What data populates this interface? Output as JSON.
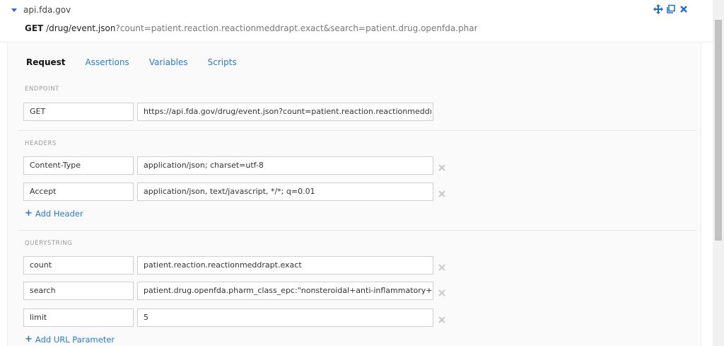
{
  "request_header": {
    "host": "api.fda.gov",
    "method": "GET",
    "path": "/drug/event.json",
    "query": "?count=patient.reaction.reactionmeddrapt.exact&search=patient.drug.openfda.pharm_class_ep"
  },
  "icons": {
    "move": "move-icon",
    "copy": "copy-icon",
    "close": "close-icon"
  },
  "tabs": [
    {
      "label": "Request",
      "active": true
    },
    {
      "label": "Assertions"
    },
    {
      "label": "Variables"
    },
    {
      "label": "Scripts"
    }
  ],
  "endpoint": {
    "label": "ENDPOINT",
    "method": "GET",
    "url": "https://api.fda.gov/drug/event.json?count=patient.reaction.reactionmeddı"
  },
  "headers": {
    "label": "HEADERS",
    "items": [
      {
        "key": "Content-Type",
        "value": "application/json; charset=utf-8"
      },
      {
        "key": "Accept",
        "value": "application/json, text/javascript, */*; q=0.01"
      }
    ],
    "add_label": "Add Header"
  },
  "querystring": {
    "label": "QUERYSTRING",
    "items": [
      {
        "key": "count",
        "value": "patient.reaction.reactionmeddrapt.exact"
      },
      {
        "key": "search",
        "value": "patient.drug.openfda.pharm_class_epc:\"nonsteroidal+anti-inflammatory+c"
      },
      {
        "key": "limit",
        "value": "5"
      }
    ],
    "add_label": "Add URL Parameter"
  },
  "colors": {
    "accent": "#2a7ac9",
    "muted": "#999999"
  }
}
